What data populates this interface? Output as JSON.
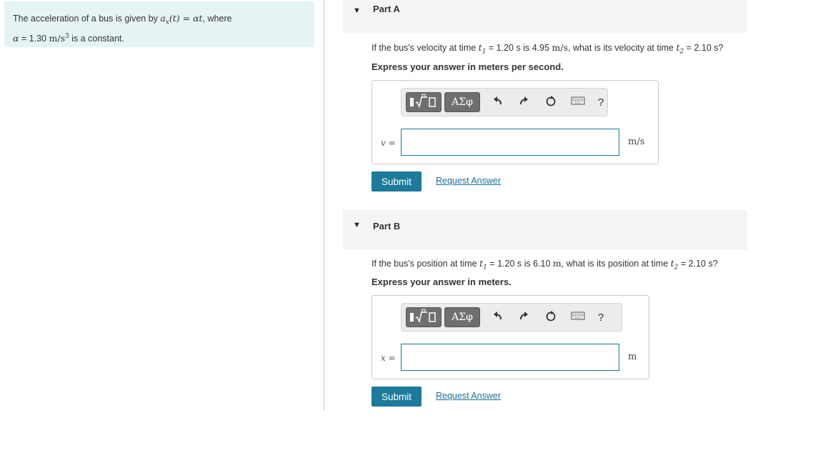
{
  "problem": {
    "text_1": "The acceleration of a bus is given by ",
    "math_1": "a",
    "math_1_sub": "x",
    "math_1b": "(t) = αt",
    "text_2": ", where",
    "math_2": "α",
    "text_3": " = 1.30 ",
    "math_3": "m/s",
    "math_3_sup": "3",
    "text_4": " is a constant."
  },
  "toolbar": {
    "template_icon": "fraction-sqrt-icon",
    "greek_label": "ΑΣφ",
    "undo_icon": "undo-icon",
    "redo_icon": "redo-icon",
    "reset_icon": "reset-icon",
    "keyboard_icon": "keyboard-icon",
    "help_label": "?"
  },
  "parts": [
    {
      "title": "Part A",
      "q_1": "If the bus's velocity at time ",
      "q_t1": "t",
      "q_t1_sub": "1",
      "q_2": " = 1.20 s is 4.95 ",
      "q_unit": "m/s",
      "q_3": ", what is its velocity at time ",
      "q_t2": "t",
      "q_t2_sub": "2",
      "q_4": " = 2.10 s?",
      "instruction": "Express your answer in meters per second.",
      "var_label": "v =",
      "input_value": "",
      "unit": "m/s",
      "submit_label": "Submit",
      "request_label": "Request Answer"
    },
    {
      "title": "Part B",
      "q_1": "If the bus's position at time ",
      "q_t1": "t",
      "q_t1_sub": "1",
      "q_2": " = 1.20 s is 6.10 ",
      "q_unit": "m",
      "q_3": ", what is its position at time ",
      "q_t2": "t",
      "q_t2_sub": "2",
      "q_4": " = 2.10 s?",
      "instruction": "Express your answer in meters.",
      "var_label": "x =",
      "input_value": "",
      "unit": "m",
      "submit_label": "Submit",
      "request_label": "Request Answer"
    }
  ],
  "colors": {
    "problem_bg": "#e6f3f5",
    "accent": "#1c7a9a",
    "link": "#1c6e97",
    "part_header_bg": "#f5f5f5"
  }
}
